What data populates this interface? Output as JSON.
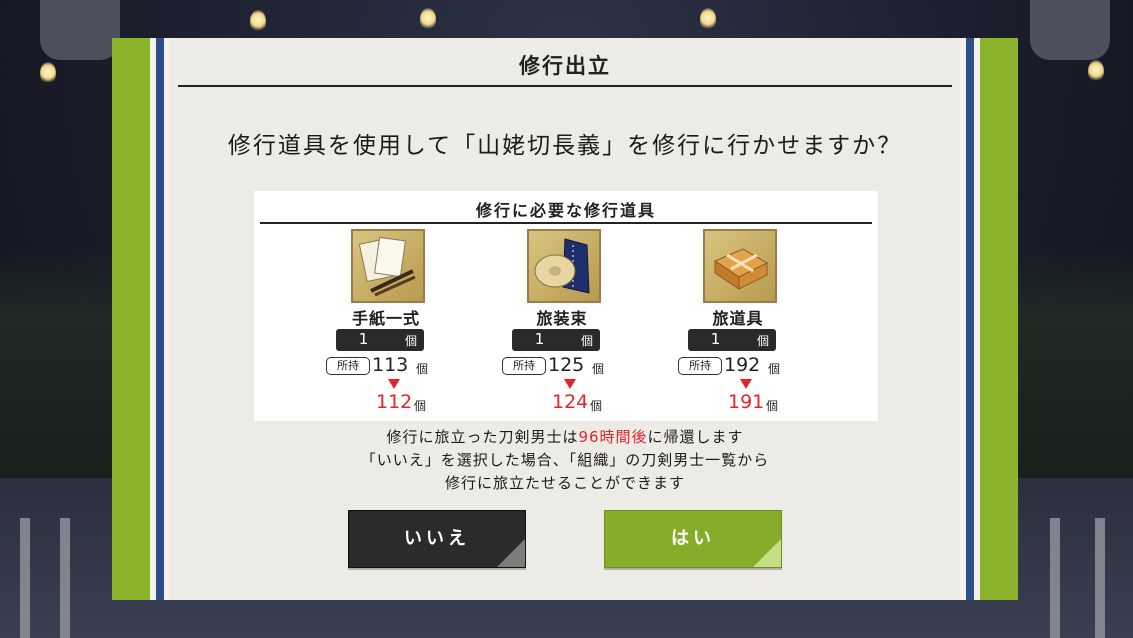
{
  "dialog": {
    "title": "修行出立",
    "question": "修行道具を使用して「山姥切長義」を修行に行かせますか？",
    "requirements_title": "修行に必要な修行道具",
    "items": [
      {
        "name": "手紙一式",
        "required": "1",
        "required_unit": "個",
        "owned_label": "所持",
        "owned": "113",
        "owned_unit": "個",
        "after": "112",
        "after_unit": "個",
        "icon": "letter-set-icon"
      },
      {
        "name": "旅装束",
        "required": "1",
        "required_unit": "個",
        "owned_label": "所持",
        "owned": "125",
        "owned_unit": "個",
        "after": "124",
        "after_unit": "個",
        "icon": "travel-outfit-icon"
      },
      {
        "name": "旅道具",
        "required": "1",
        "required_unit": "個",
        "owned_label": "所持",
        "owned": "192",
        "owned_unit": "個",
        "after": "191",
        "after_unit": "個",
        "icon": "travel-tools-icon"
      }
    ],
    "note_line1_pre": "修行に旅立った刀剣男士は",
    "note_line1_hl": "96時間後",
    "note_line1_post": "に帰還します",
    "note_line2": "「いいえ」を選択した場合、「組織」の刀剣男士一覧から",
    "note_line3": "修行に旅立たせることができます",
    "no_label": "いいえ",
    "yes_label": "はい"
  },
  "colors": {
    "frame_green": "#8bb32c",
    "stripe_blue": "#2d4f8c",
    "highlight_red": "#e8222a",
    "button_no": "#2b2b2b",
    "button_yes": "#86ad2a"
  }
}
